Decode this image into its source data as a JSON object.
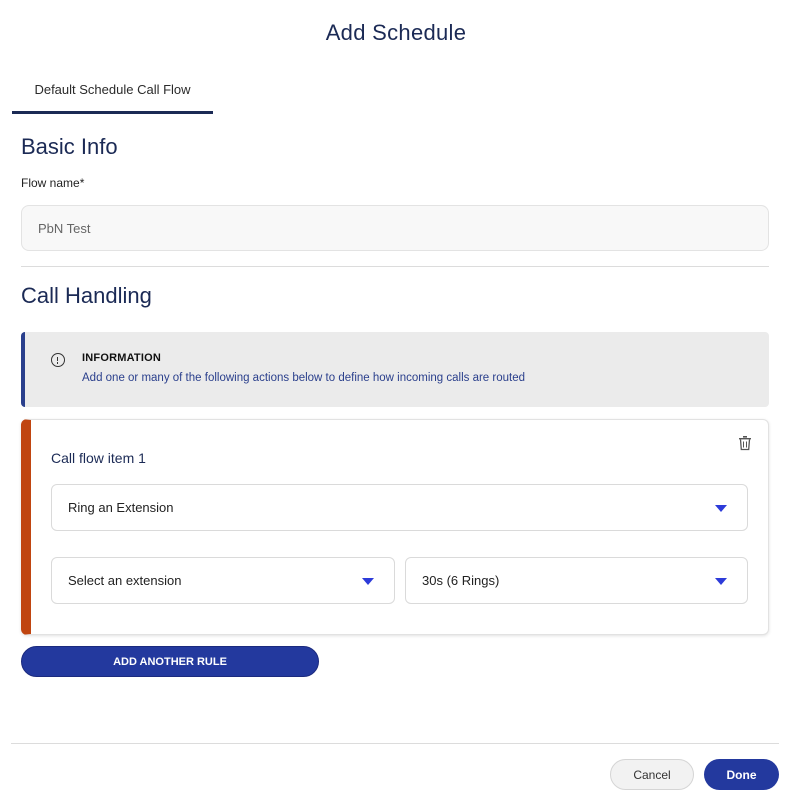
{
  "dialog": {
    "title": "Add Schedule"
  },
  "tabs": [
    {
      "label": "Default Schedule Call Flow",
      "active": true
    }
  ],
  "basic_info": {
    "heading": "Basic Info",
    "flow_name_label": "Flow name*",
    "flow_name_value": "PbN Test"
  },
  "call_handling": {
    "heading": "Call Handling",
    "info": {
      "title": "INFORMATION",
      "text": "Add one or many of the following actions below to define how incoming calls are routed",
      "icon": "info-circle-icon"
    },
    "items": [
      {
        "title": "Call flow item 1",
        "action_select": "Ring an Extension",
        "extension_select": "Select an extension",
        "ring_select": "30s (6 Rings)",
        "delete_icon": "trash-icon"
      }
    ],
    "add_rule_label": "ADD ANOTHER RULE"
  },
  "footer": {
    "cancel_label": "Cancel",
    "done_label": "Done"
  },
  "colors": {
    "primary": "#23399e",
    "heading": "#1b2a55",
    "card_accent": "#c04510",
    "info_accent": "#2a3f8c",
    "caret": "#2d3bd9"
  }
}
